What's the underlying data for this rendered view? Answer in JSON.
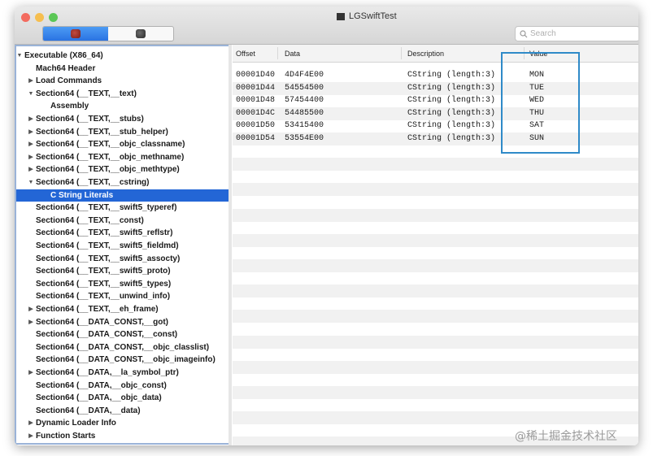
{
  "window": {
    "title": "LGSwiftTest"
  },
  "toolbar": {
    "segments": [
      {
        "icon": "red-app-icon",
        "active": true
      },
      {
        "icon": "dark-app-icon",
        "active": false
      }
    ],
    "search": {
      "placeholder": "Search",
      "value": ""
    }
  },
  "sidebar": {
    "items": [
      {
        "label": "Executable  (X86_64)",
        "level": 0,
        "disclosure": "expanded",
        "selected": false
      },
      {
        "label": "Mach64 Header",
        "level": 1,
        "disclosure": "none",
        "selected": false
      },
      {
        "label": "Load Commands",
        "level": 1,
        "disclosure": "collapsed",
        "selected": false
      },
      {
        "label": "Section64 (__TEXT,__text)",
        "level": 1,
        "disclosure": "expanded",
        "selected": false
      },
      {
        "label": "Assembly",
        "level": 2,
        "disclosure": "none",
        "selected": false
      },
      {
        "label": "Section64 (__TEXT,__stubs)",
        "level": 1,
        "disclosure": "collapsed",
        "selected": false
      },
      {
        "label": "Section64 (__TEXT,__stub_helper)",
        "level": 1,
        "disclosure": "collapsed",
        "selected": false
      },
      {
        "label": "Section64 (__TEXT,__objc_classname)",
        "level": 1,
        "disclosure": "collapsed",
        "selected": false
      },
      {
        "label": "Section64 (__TEXT,__objc_methname)",
        "level": 1,
        "disclosure": "collapsed",
        "selected": false
      },
      {
        "label": "Section64 (__TEXT,__objc_methtype)",
        "level": 1,
        "disclosure": "collapsed",
        "selected": false
      },
      {
        "label": "Section64 (__TEXT,__cstring)",
        "level": 1,
        "disclosure": "expanded",
        "selected": false
      },
      {
        "label": "C String Literals",
        "level": 2,
        "disclosure": "none",
        "selected": true
      },
      {
        "label": "Section64 (__TEXT,__swift5_typeref)",
        "level": 1,
        "disclosure": "none",
        "selected": false
      },
      {
        "label": "Section64 (__TEXT,__const)",
        "level": 1,
        "disclosure": "none",
        "selected": false
      },
      {
        "label": "Section64 (__TEXT,__swift5_reflstr)",
        "level": 1,
        "disclosure": "none",
        "selected": false
      },
      {
        "label": "Section64 (__TEXT,__swift5_fieldmd)",
        "level": 1,
        "disclosure": "none",
        "selected": false
      },
      {
        "label": "Section64 (__TEXT,__swift5_assocty)",
        "level": 1,
        "disclosure": "none",
        "selected": false
      },
      {
        "label": "Section64 (__TEXT,__swift5_proto)",
        "level": 1,
        "disclosure": "none",
        "selected": false
      },
      {
        "label": "Section64 (__TEXT,__swift5_types)",
        "level": 1,
        "disclosure": "none",
        "selected": false
      },
      {
        "label": "Section64 (__TEXT,__unwind_info)",
        "level": 1,
        "disclosure": "none",
        "selected": false
      },
      {
        "label": "Section64 (__TEXT,__eh_frame)",
        "level": 1,
        "disclosure": "collapsed",
        "selected": false
      },
      {
        "label": "Section64 (__DATA_CONST,__got)",
        "level": 1,
        "disclosure": "collapsed",
        "selected": false
      },
      {
        "label": "Section64 (__DATA_CONST,__const)",
        "level": 1,
        "disclosure": "none",
        "selected": false
      },
      {
        "label": "Section64 (__DATA_CONST,__objc_classlist)",
        "level": 1,
        "disclosure": "none",
        "selected": false
      },
      {
        "label": "Section64 (__DATA_CONST,__objc_imageinfo)",
        "level": 1,
        "disclosure": "none",
        "selected": false
      },
      {
        "label": "Section64 (__DATA,__la_symbol_ptr)",
        "level": 1,
        "disclosure": "collapsed",
        "selected": false
      },
      {
        "label": "Section64 (__DATA,__objc_const)",
        "level": 1,
        "disclosure": "none",
        "selected": false
      },
      {
        "label": "Section64 (__DATA,__objc_data)",
        "level": 1,
        "disclosure": "none",
        "selected": false
      },
      {
        "label": "Section64 (__DATA,__data)",
        "level": 1,
        "disclosure": "none",
        "selected": false
      },
      {
        "label": "Dynamic Loader Info",
        "level": 1,
        "disclosure": "collapsed",
        "selected": false
      },
      {
        "label": "Function Starts",
        "level": 1,
        "disclosure": "collapsed",
        "selected": false
      }
    ]
  },
  "table": {
    "columns": [
      "Offset",
      "Data",
      "Description",
      "Value"
    ],
    "rows": [
      {
        "offset": "00001D40",
        "data": "4D4F4E00",
        "description": "CString (length:3)",
        "value": "MON"
      },
      {
        "offset": "00001D44",
        "data": "54554500",
        "description": "CString (length:3)",
        "value": "TUE"
      },
      {
        "offset": "00001D48",
        "data": "57454400",
        "description": "CString (length:3)",
        "value": "WED"
      },
      {
        "offset": "00001D4C",
        "data": "54485500",
        "description": "CString (length:3)",
        "value": "THU"
      },
      {
        "offset": "00001D50",
        "data": "53415400",
        "description": "CString (length:3)",
        "value": "SAT"
      },
      {
        "offset": "00001D54",
        "data": "53554E00",
        "description": "CString (length:3)",
        "value": "SUN"
      }
    ]
  },
  "watermark": "@稀土掘金技术社区",
  "colors": {
    "selection": "#2366d6",
    "highlight_box": "#2f8ac8",
    "segment_active": "#2a73e2"
  }
}
